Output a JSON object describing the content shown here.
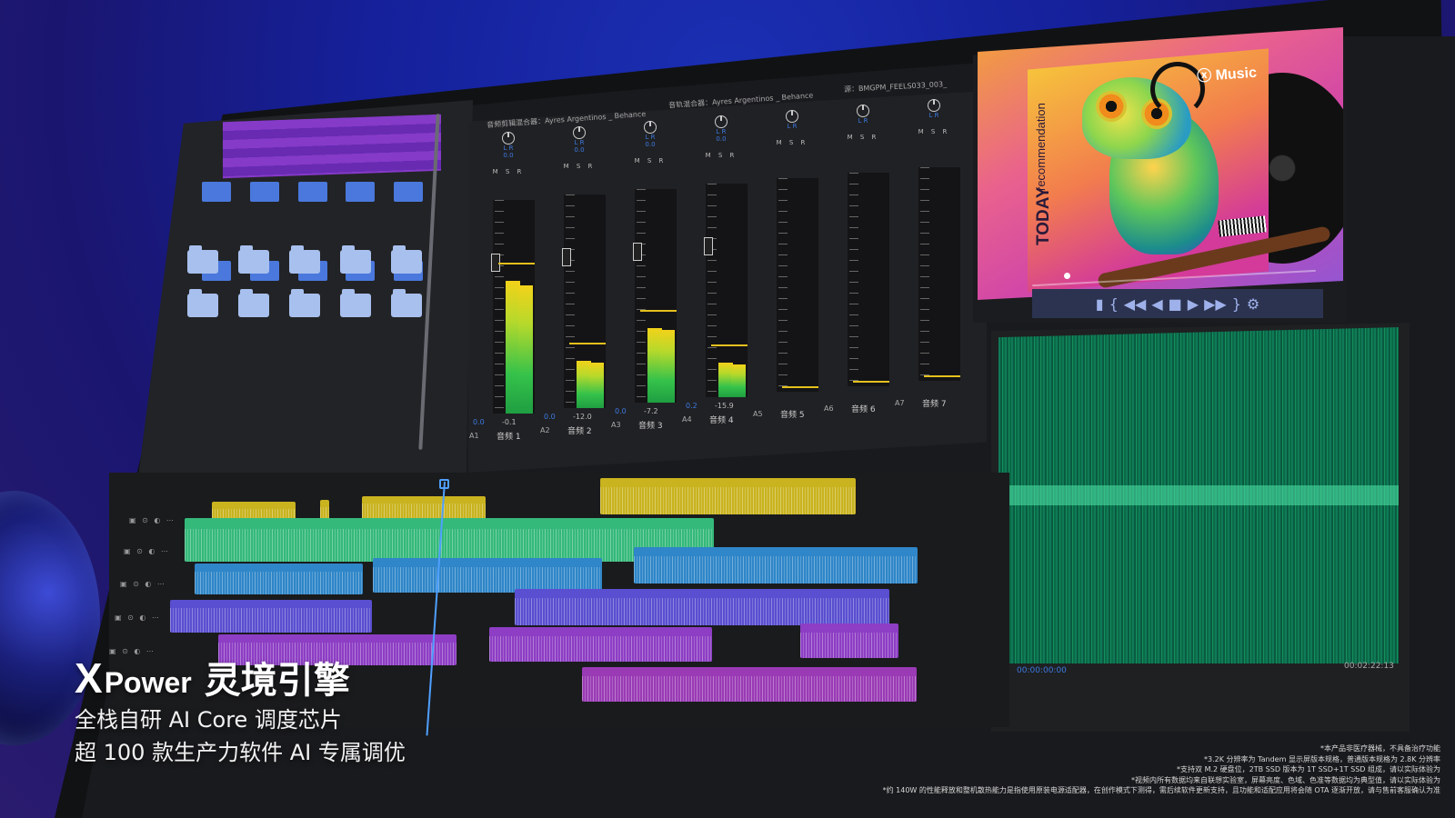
{
  "mixer": {
    "header_left": "音频剪辑混合器：Ayres Argentinos _ Behance",
    "header_mid": "音轨混合器：Ayres Argentinos _ Behance",
    "header_right": "源：BMGPM_FEELS033_003_",
    "channels": [
      {
        "id": "A1",
        "name": "音频 1",
        "pan": "0.0",
        "value": "-0.1",
        "blue_value": "0.0",
        "level": 0.62
      },
      {
        "id": "A2",
        "name": "音频 2",
        "pan": "0.0",
        "value": "-12.0",
        "blue_value": "0.0",
        "level": 0.22
      },
      {
        "id": "A3",
        "name": "音频 3",
        "pan": "0.0",
        "value": "-7.2",
        "blue_value": "0.0",
        "level": 0.35
      },
      {
        "id": "A4",
        "name": "音频 4",
        "pan": "0.0",
        "value": "-15.9",
        "blue_value": "0.2",
        "level": 0.16
      },
      {
        "id": "A5",
        "name": "音频 5",
        "pan": "",
        "value": "",
        "blue_value": "",
        "level": 0
      },
      {
        "id": "A6",
        "name": "音频 6",
        "pan": "",
        "value": "",
        "blue_value": "",
        "level": 0
      },
      {
        "id": "A7",
        "name": "音频 7",
        "pan": "",
        "value": "",
        "blue_value": "",
        "level": 0
      }
    ],
    "lr_label": "L R",
    "msr_label": "M S R"
  },
  "album": {
    "brand": "Music",
    "today": "TODAY",
    "recommendation": "recommendation",
    "progress": 0.12
  },
  "transport": {
    "icons": [
      "marker-icon",
      "in-point-icon",
      "rewind-icon",
      "step-back-icon",
      "stop-icon",
      "play-icon",
      "fast-forward-icon",
      "out-point-icon",
      "settings-icon"
    ],
    "glyphs": [
      "▮",
      "{",
      "◀◀",
      "◀",
      "■",
      "▶",
      "▶▶",
      "}",
      "⚙"
    ]
  },
  "waveform": {
    "time_start": "00:00:00:00",
    "time_end": "00:02:22:13"
  },
  "overlay": {
    "brand_x": "X",
    "brand_power": "Power",
    "brand_cn": "灵境引擎",
    "line1": "全栈自研 AI Core 调度芯片",
    "line2": "超 100 款生产力软件 AI 专属调优"
  },
  "disclaimer": [
    "*本产品非医疗器械，不具备治疗功能",
    "*3.2K 分辨率为 Tandem 显示屏版本规格，普通版本规格为 2.8K 分辨率",
    "*支持双 M.2 硬盘位，2TB SSD 版本为 1T SSD+1T SSD 组成，请以实际体验为",
    "*视频内所有数据均来自联想实验室，屏幕亮度、色域、色准等数据均为典型值，请以实际体验为",
    "*约 140W 的性能释放和整机散热能力是指使用原装电源适配器，在创作模式下测得，需后续软件更新支持，且功能和适配应用将会随 OTA 逐渐开放，请与售前客服确认为准"
  ]
}
